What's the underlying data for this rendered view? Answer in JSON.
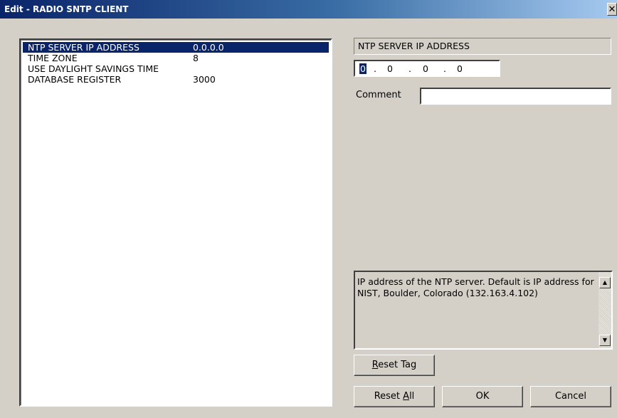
{
  "window": {
    "title": "Edit - RADIO SNTP CLIENT",
    "close_glyph": "✕"
  },
  "list": {
    "items": [
      {
        "label": "NTP SERVER IP ADDRESS",
        "value": "0.0.0.0",
        "selected": true
      },
      {
        "label": "TIME ZONE",
        "value": "8",
        "selected": false
      },
      {
        "label": "USE DAYLIGHT SAVINGS TIME",
        "value": "",
        "selected": false
      },
      {
        "label": "DATABASE REGISTER",
        "value": "3000",
        "selected": false
      }
    ]
  },
  "editor": {
    "field_title": "NTP SERVER IP ADDRESS",
    "ip": {
      "octets": [
        "0",
        "0",
        "0",
        "0"
      ],
      "separator": "."
    },
    "comment_label": "Comment",
    "comment_value": "",
    "description": "IP address of the NTP server. Default is IP address for NIST, Boulder, Colorado (132.163.4.102)"
  },
  "buttons": {
    "reset_tag": {
      "pre": "",
      "accel": "R",
      "post": "eset Tag"
    },
    "reset_all": {
      "pre": "Reset ",
      "accel": "A",
      "post": "ll"
    },
    "ok": "OK",
    "cancel": "Cancel"
  },
  "icons": {
    "scroll_up": "▲",
    "scroll_down": "▼"
  }
}
